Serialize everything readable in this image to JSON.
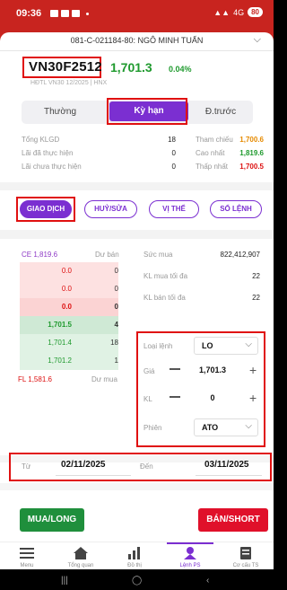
{
  "status_bar": {
    "time": "09:36",
    "signal": "4G",
    "battery": "80"
  },
  "account": {
    "label": "081-C-021184-80: NGÔ MINH TUẤN"
  },
  "instrument": {
    "symbol": "VN30F2512",
    "price": "1,701.3",
    "change_pct": "0.04%",
    "sub_info": "HĐTL VN30 12/2025 | HNX"
  },
  "tabs": [
    {
      "label": "Thường"
    },
    {
      "label": "Kỳ hạn",
      "active": true
    },
    {
      "label": "Đ.trước"
    }
  ],
  "stats": {
    "left": [
      {
        "label": "Tổng KLGD",
        "value": "18"
      },
      {
        "label": "Lãi đã thực hiện",
        "value": "0"
      },
      {
        "label": "Lãi chưa thực hiện",
        "value": "0"
      }
    ],
    "right": [
      {
        "label": "Tham chiếu",
        "value": "1,700.6",
        "color": "#e68a00"
      },
      {
        "label": "Cao nhất",
        "value": "1,819.6",
        "color": "#1f9a2e"
      },
      {
        "label": "Thấp nhất",
        "value": "1,700.5",
        "color": "#d11"
      }
    ]
  },
  "actions": [
    "GIAO DỊCH",
    "HUỶ/SỬA",
    "VỊ THẾ",
    "SỔ LỆNH"
  ],
  "order_book": {
    "ceiling_label": "CE 1,819.6",
    "sell_header": "Dư bán",
    "sell": [
      {
        "price": "0.0",
        "vol": "0"
      },
      {
        "price": "0.0",
        "vol": "0"
      },
      {
        "price": "0.0",
        "vol": "0"
      }
    ],
    "buy": [
      {
        "price": "1,701.5",
        "vol": "4"
      },
      {
        "price": "1,701.4",
        "vol": "18"
      },
      {
        "price": "1,701.2",
        "vol": "1"
      }
    ],
    "floor_label": "FL 1,581.6",
    "buy_header": "Dư mua"
  },
  "account_info": [
    {
      "label": "Sức mua",
      "value": "822,412,907"
    },
    {
      "label": "KL mua tối đa",
      "value": "22"
    },
    {
      "label": "KL bán tối đa",
      "value": "22"
    }
  ],
  "order_form": {
    "order_type_label": "Loại lệnh",
    "order_type": "LO",
    "price_label": "Giá",
    "price": "1,701.3",
    "qty_label": "KL",
    "qty": "0",
    "session_label": "Phiên",
    "session": "ATO"
  },
  "dates": {
    "from_label": "Từ",
    "from": "02/11/2025",
    "to_label": "Đến",
    "to": "03/11/2025"
  },
  "buy_button": "MUA/LONG",
  "sell_button": "BÁN/SHORT",
  "bottom_nav": [
    "Menu",
    "Tổng quan",
    "Đồ thị",
    "Lệnh PS",
    "Cơ cấu TS"
  ],
  "colors": {
    "primary_purple": "#7b2fd1",
    "header_red": "#c8241f",
    "buy_green": "#1f8f3c",
    "sell_red": "#e0102a"
  }
}
